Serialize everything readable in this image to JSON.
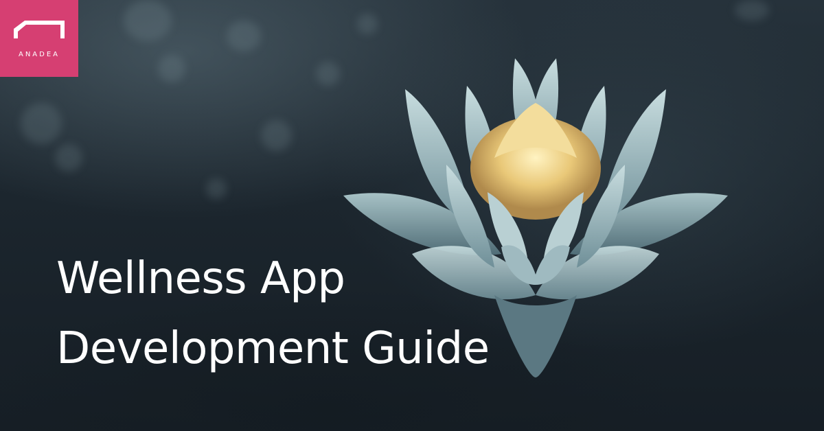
{
  "brand": {
    "name": "ANADEA",
    "color": "#d63f72"
  },
  "headline": {
    "line1": "Wellness App",
    "line2": "Development Guide"
  },
  "image": {
    "subject": "lotus-flower-icon"
  }
}
